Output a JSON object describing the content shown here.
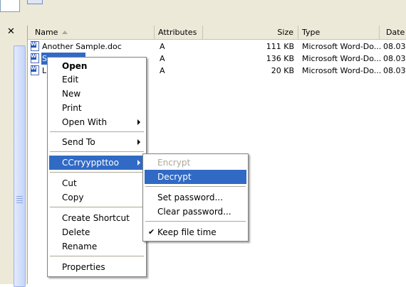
{
  "sidebar": {
    "close_glyph": "✕"
  },
  "columns": [
    {
      "label": "Name"
    },
    {
      "label": "Attributes"
    },
    {
      "label": "Size"
    },
    {
      "label": "Type"
    },
    {
      "label": "Date"
    }
  ],
  "files": [
    {
      "name": "Another Sample.doc",
      "attributes": "A",
      "size": "111 KB",
      "type": "Microsoft Word-Do...",
      "date": "08.03"
    },
    {
      "name": "S",
      "attributes": "A",
      "size": "136 KB",
      "type": "Microsoft Word-Do...",
      "date": "08.03"
    },
    {
      "name": "L",
      "attributes": "A",
      "size": "20 KB",
      "type": "Microsoft Word-Do...",
      "date": "08.03"
    }
  ],
  "context_menu": {
    "open": "Open",
    "edit": "Edit",
    "new": "New",
    "print": "Print",
    "open_with": "Open With",
    "send_to": "Send To",
    "ccrypto": "CCrryyppttoo",
    "cut": "Cut",
    "copy": "Copy",
    "create_shortcut": "Create Shortcut",
    "delete": "Delete",
    "rename": "Rename",
    "properties": "Properties"
  },
  "submenu": {
    "encrypt": "Encrypt",
    "decrypt": "Decrypt",
    "set_password": "Set password...",
    "clear_password": "Clear password...",
    "keep_file_time": "Keep file time",
    "check_glyph": "✔"
  },
  "colors": {
    "highlight": "#316ac5",
    "chrome": "#ece9d8",
    "disabled": "#aca899"
  }
}
